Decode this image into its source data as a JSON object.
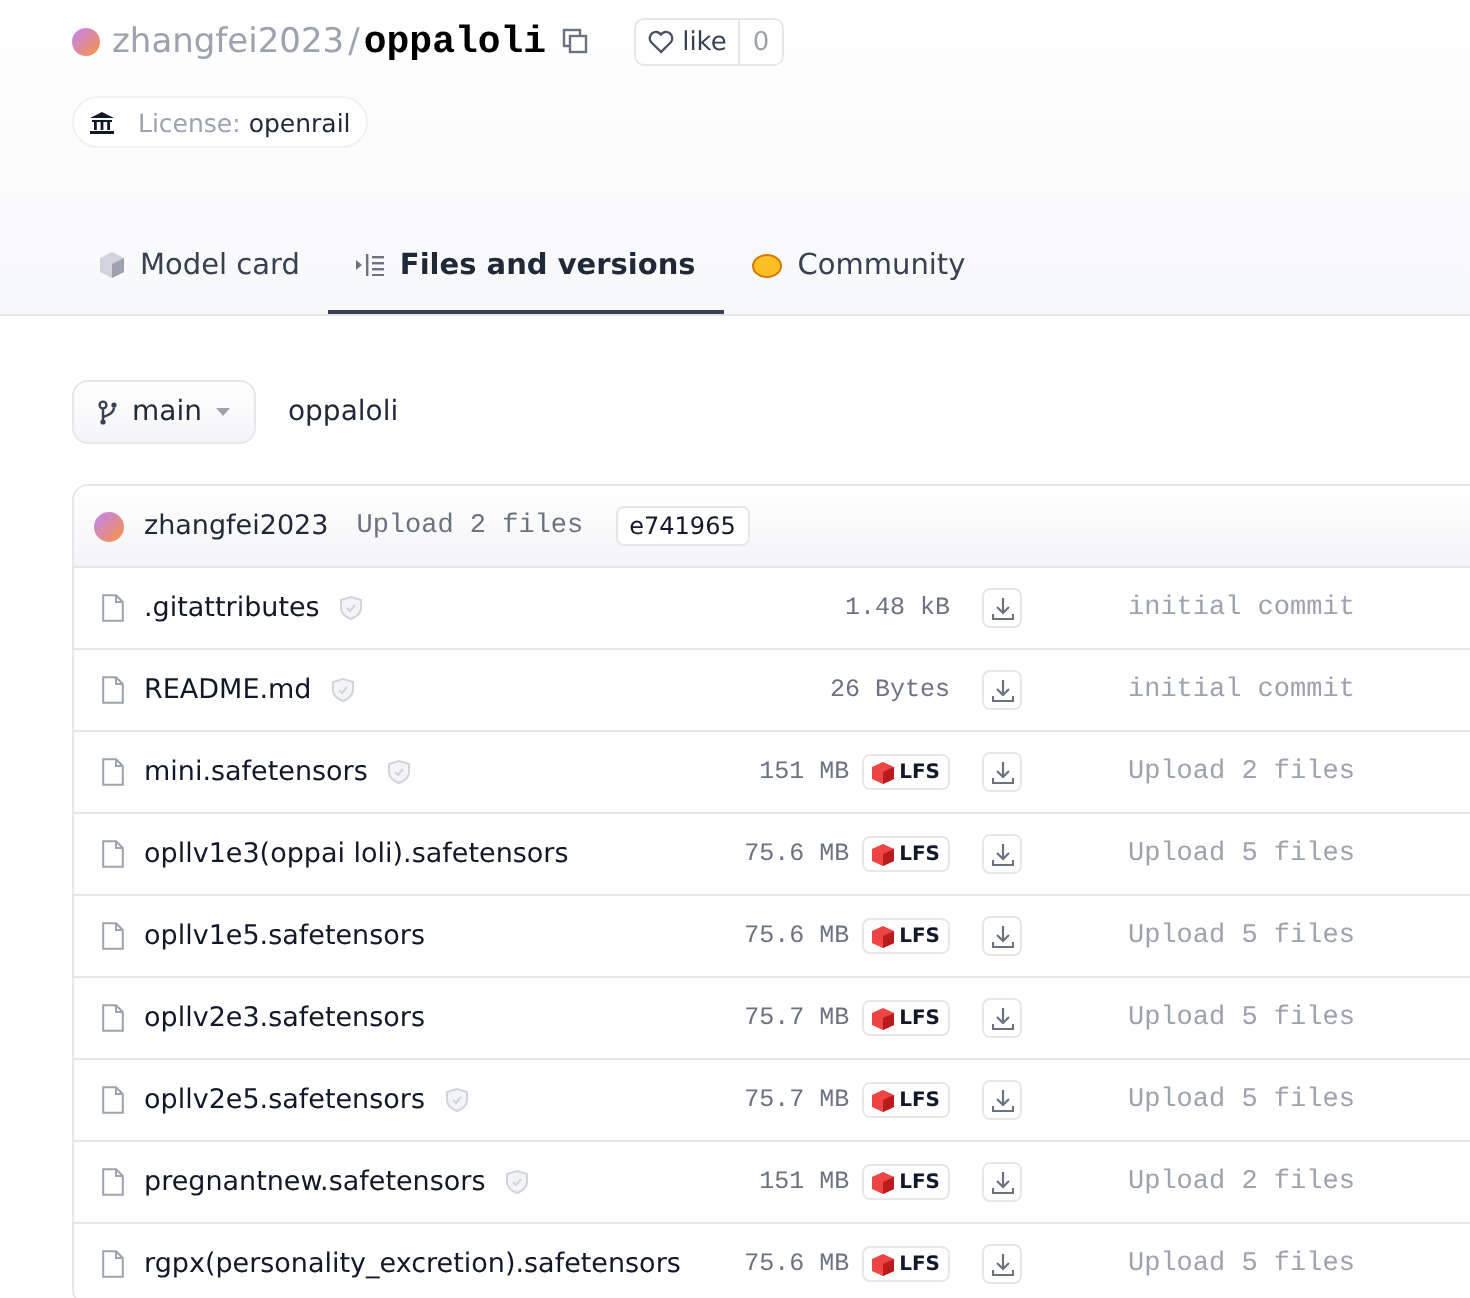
{
  "repo": {
    "owner": "zhangfei2023",
    "separator": "/",
    "name": "oppaloli",
    "like_label": "like",
    "like_count": "0"
  },
  "license": {
    "label": "License:",
    "value": "openrail"
  },
  "tabs": [
    {
      "label": "Model card",
      "selected": false
    },
    {
      "label": "Files and versions",
      "selected": true
    },
    {
      "label": "Community",
      "selected": false
    }
  ],
  "branch": {
    "name": "main",
    "path": "oppaloli"
  },
  "commit": {
    "author": "zhangfei2023",
    "message": "Upload 2 files",
    "hash": "e741965"
  },
  "files": [
    {
      "name": ".gitattributes",
      "safe": true,
      "size": "1.48 kB",
      "commit": "initial commit"
    },
    {
      "name": "README.md",
      "safe": true,
      "size": "26 Bytes",
      "commit": "initial commit"
    },
    {
      "name": "mini.safetensors",
      "safe": true,
      "size": "151 MB",
      "badge": "LFS",
      "commit": "Upload 2 files"
    },
    {
      "name": "opllv1e3(oppai loli).safetensors",
      "safe": false,
      "size": "75.6 MB",
      "badge": "LFS",
      "commit": "Upload 5 files"
    },
    {
      "name": "opllv1e5.safetensors",
      "safe": false,
      "size": "75.6 MB",
      "badge": "LFS",
      "commit": "Upload 5 files"
    },
    {
      "name": "opllv2e3.safetensors",
      "safe": false,
      "size": "75.7 MB",
      "badge": "LFS",
      "commit": "Upload 5 files"
    },
    {
      "name": "opllv2e5.safetensors",
      "safe": true,
      "size": "75.7 MB",
      "badge": "LFS",
      "commit": "Upload 5 files"
    },
    {
      "name": "pregnantnew.safetensors",
      "safe": true,
      "size": "151 MB",
      "badge": "LFS",
      "commit": "Upload 2 files"
    },
    {
      "name": "rgpx(personality_excretion).safetensors",
      "safe": false,
      "size": "75.6 MB",
      "badge": "LFS",
      "commit": "Upload 5 files"
    }
  ]
}
